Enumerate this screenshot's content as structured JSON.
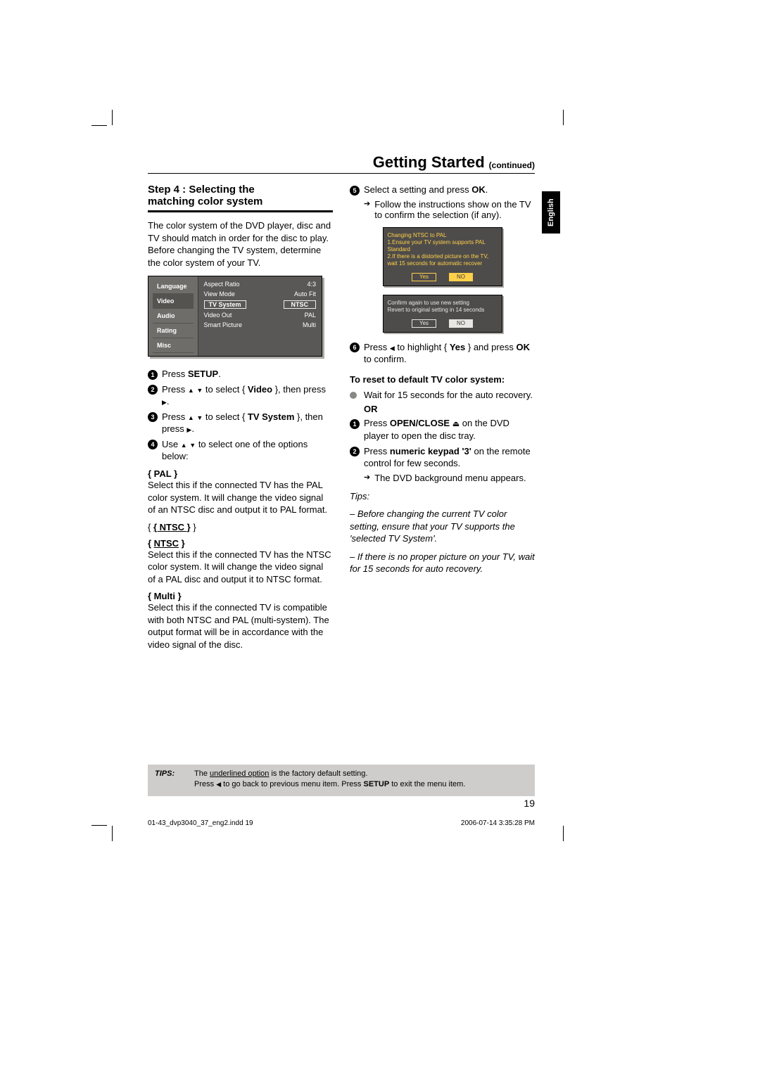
{
  "header": {
    "title": "Getting Started",
    "continued": "(continued)"
  },
  "lang_tab": "English",
  "step": {
    "heading_line1": "Step 4 : Selecting the",
    "heading_line2": "matching color system",
    "intro": "The color system of the DVD player, disc and TV should match in order for the disc to play. Before changing the TV system, determine the color system of your TV."
  },
  "osd": {
    "tabs": [
      "Language",
      "Video",
      "Audio",
      "Rating",
      "Misc"
    ],
    "rows": [
      {
        "k": "Aspect Ratio",
        "v": "4:3"
      },
      {
        "k": "View Mode",
        "v": "Auto Fit"
      },
      {
        "k": "TV System",
        "v": "NTSC",
        "hl": true
      },
      {
        "k": "Video Out",
        "v": "PAL"
      },
      {
        "k": "Smart Picture",
        "v": "Multi"
      }
    ]
  },
  "steps_left": {
    "s1_a": "Press ",
    "s1_b": "SETUP",
    "s1_c": ".",
    "s2_a": "Press ",
    "s2_b": " to select { ",
    "s2_c": "Video",
    "s2_d": " }, then press ",
    "s2_e": ".",
    "s3_a": "Press ",
    "s3_b": " to select { ",
    "s3_c": "TV System",
    "s3_d": " }, then press ",
    "s3_e": ".",
    "s4_a": "Use ",
    "s4_b": " to select one of the options below:"
  },
  "options": {
    "pal_h": "{ PAL }",
    "pal_t": "Select this if the connected TV has the PAL color system. It will change the video signal of an NTSC disc and output it to PAL format.",
    "ntsc_h": "{ NTSC }",
    "ntsc_t": "Select this if the connected TV has the NTSC color system. It will change the video signal of a PAL disc and output it to NTSC format.",
    "multi_h": "{ Multi }",
    "multi_t": "Select this if the connected TV is compatible with both NTSC and PAL (multi-system). The output format will be in accordance with the video signal of the disc."
  },
  "right": {
    "s5_a": "Select a setting and press ",
    "s5_b": "OK",
    "s5_c": ".",
    "s5_sub": "Follow the instructions show on the TV to confirm the selection (if any).",
    "s6_a": "Press ",
    "s6_b": " to highlight { ",
    "s6_c": "Yes",
    "s6_d": " } and press ",
    "s6_e": "OK",
    "s6_f": " to confirm.",
    "reset_h": "To reset to default TV color system:",
    "r_bullet": "Wait for 15 seconds for the auto recovery.",
    "or": "OR",
    "r1_a": "Press ",
    "r1_b": "OPEN/CLOSE",
    "r1_c": " on the DVD player to open the disc tray.",
    "r2_a": "Press ",
    "r2_b": "numeric keypad '3'",
    "r2_c": " on the remote control for few seconds.",
    "r2_sub": "The DVD background menu appears.",
    "tips_h": "Tips:",
    "tips_1": "– Before changing the current TV color setting, ensure that your TV supports the 'selected TV System'.",
    "tips_2": "– If there is no proper picture on your TV, wait for 15 seconds for auto recovery."
  },
  "confirm1": {
    "l1": "Changing NTSC to PAL",
    "l2": "1.Ensure your TV system supports PAL Standard",
    "l3": "2.If there is a distorted picture on the TV, wait 15 seconds for automatic recover",
    "yes": "Yes",
    "no": "NO"
  },
  "confirm2": {
    "l1": "Confirm again to use new setting",
    "l2": "Revert to original setting in 14 seconds",
    "yes": "Yes",
    "no": "NO"
  },
  "tips_bar": {
    "label": "TIPS:",
    "l1_a": "The ",
    "l1_u": "underlined option",
    "l1_b": " is the factory default setting.",
    "l2_a": "Press ",
    "l2_b": " to go back to previous menu item. Press ",
    "l2_c": "SETUP",
    "l2_d": " to exit the menu item."
  },
  "page_number": "19",
  "footer": {
    "left": "01-43_dvp3040_37_eng2.indd   19",
    "right": "2006-07-14   3:35:28 PM"
  }
}
